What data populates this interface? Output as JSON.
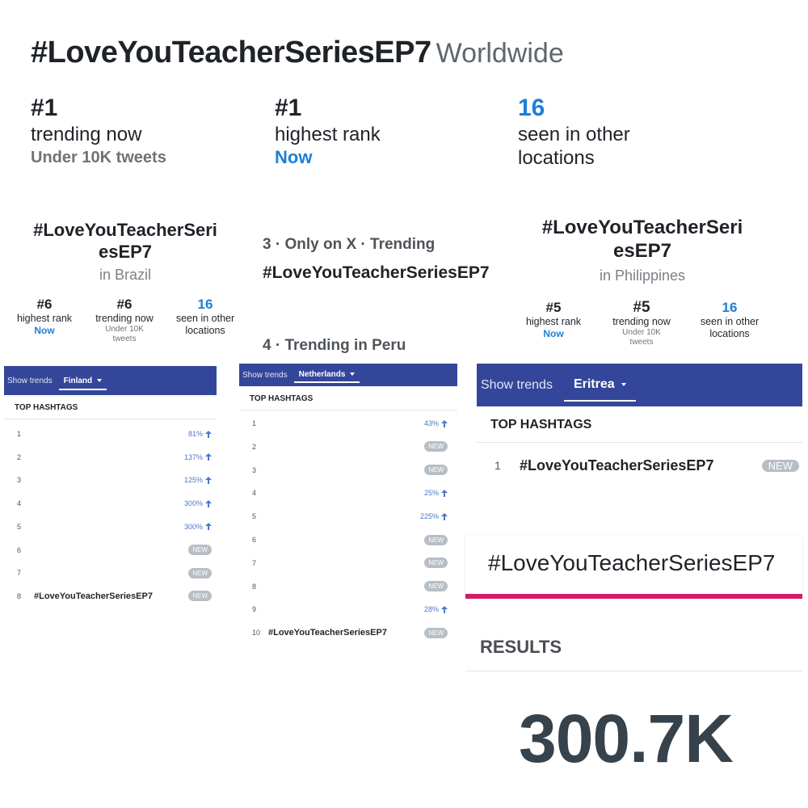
{
  "header": {
    "hashtag": "#LoveYouTeacherSeriesEP7",
    "location": "Worldwide"
  },
  "worldwide_stats": [
    {
      "value": "#1",
      "label": "trending now",
      "sub": "Under 10K tweets",
      "value_color": "#1f2328",
      "sub_color": "#6e7378"
    },
    {
      "value": "#1",
      "label": "highest rank",
      "sub": "Now",
      "value_color": "#1f2328",
      "sub_color": "#1d7fd6"
    },
    {
      "value": "16",
      "label_line1": "seen in other",
      "label_line2": "locations",
      "value_color": "#1d7fd6"
    }
  ],
  "brazil": {
    "tag_line1": "#LoveYouTeacherSeri",
    "tag_line2": "esEP7",
    "in": "in Brazil",
    "highest": {
      "value": "#6",
      "label": "highest rank",
      "sub": "Now"
    },
    "trending": {
      "value": "#6",
      "label": "trending now",
      "sub1": "Under 10K",
      "sub2": "tweets"
    },
    "seen": {
      "value": "16",
      "label1": "seen in other",
      "label2": "locations"
    }
  },
  "philippines": {
    "tag_line1": "#LoveYouTeacherSeri",
    "tag_line2": "esEP7",
    "in": "in Philippines",
    "highest": {
      "value": "#5",
      "label": "highest rank",
      "sub": "Now"
    },
    "trending": {
      "value": "#5",
      "label": "trending now",
      "sub1": "Under 10K",
      "sub2": "tweets"
    },
    "seen": {
      "value": "16",
      "label1": "seen in other",
      "label2": "locations"
    }
  },
  "x_trending": {
    "line": "3 · Only on X · Trending",
    "hashtag": "#LoveYouTeacherSeriesEP7"
  },
  "peru": {
    "line": "4 · Trending in Peru"
  },
  "finland_panel": {
    "show_trends": "Show trends",
    "country": "Finland",
    "heading": "TOP HASHTAGS",
    "rows": [
      {
        "rank": "1",
        "name": "",
        "change": "81%"
      },
      {
        "rank": "2",
        "name": "",
        "change": "137%"
      },
      {
        "rank": "3",
        "name": "",
        "change": "125%"
      },
      {
        "rank": "4",
        "name": "",
        "change": "300%"
      },
      {
        "rank": "5",
        "name": "",
        "change": "300%"
      },
      {
        "rank": "6",
        "name": "",
        "badge": "NEW"
      },
      {
        "rank": "7",
        "name": "",
        "badge": "NEW"
      },
      {
        "rank": "8",
        "name": "#LoveYouTeacherSeriesEP7",
        "badge": "NEW"
      }
    ]
  },
  "netherlands_panel": {
    "show_trends": "Show trends",
    "country": "Netherlands",
    "heading": "TOP HASHTAGS",
    "rows": [
      {
        "rank": "1",
        "name": "",
        "change": "43%"
      },
      {
        "rank": "2",
        "name": "",
        "badge": "NEW"
      },
      {
        "rank": "3",
        "name": "",
        "badge": "NEW"
      },
      {
        "rank": "4",
        "name": "",
        "change": "25%"
      },
      {
        "rank": "5",
        "name": "",
        "change": "225%"
      },
      {
        "rank": "6",
        "name": "",
        "badge": "NEW"
      },
      {
        "rank": "7",
        "name": "",
        "badge": "NEW"
      },
      {
        "rank": "8",
        "name": "",
        "badge": "NEW"
      },
      {
        "rank": "9",
        "name": "",
        "change": "28%"
      },
      {
        "rank": "10",
        "name": "#LoveYouTeacherSeriesEP7",
        "badge": "NEW"
      }
    ]
  },
  "eritrea_panel": {
    "show_trends": "Show trends",
    "country": "Eritrea",
    "heading": "TOP HASHTAGS",
    "rows": [
      {
        "rank": "1",
        "name": "#LoveYouTeacherSeriesEP7",
        "badge": "NEW"
      }
    ]
  },
  "search": {
    "hashtag": "#LoveYouTeacherSeriesEP7",
    "accent": "#d21a6b"
  },
  "results": {
    "label": "RESULTS",
    "count": "300.7K"
  },
  "colors": {
    "bar": "#34469a",
    "blue": "#1d7fd6",
    "change": "#4a78c9",
    "badge": "#b7bec5"
  }
}
